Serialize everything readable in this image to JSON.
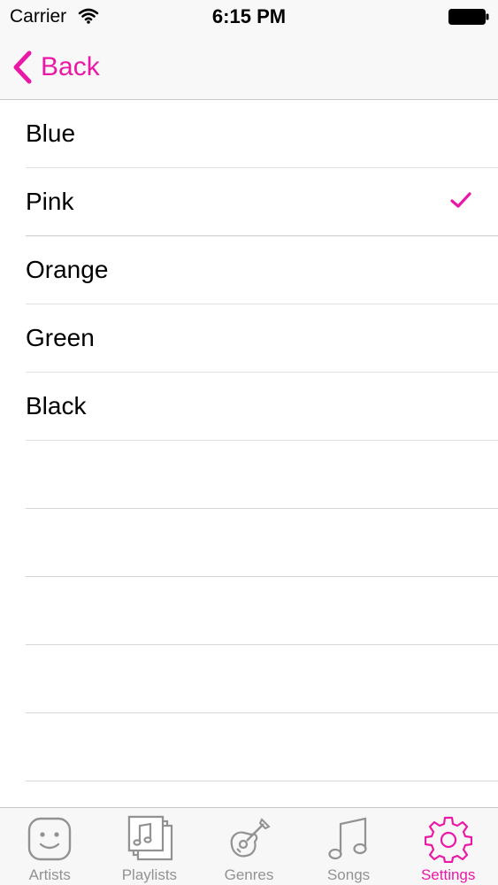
{
  "status_bar": {
    "carrier": "Carrier",
    "time": "6:15 PM"
  },
  "nav": {
    "back_label": "Back"
  },
  "colors": {
    "accent": "#e919a6",
    "inactive": "#929292"
  },
  "list": {
    "items": [
      {
        "label": "Blue",
        "selected": false
      },
      {
        "label": "Pink",
        "selected": true
      },
      {
        "label": "Orange",
        "selected": false
      },
      {
        "label": "Green",
        "selected": false
      },
      {
        "label": "Black",
        "selected": false
      }
    ],
    "empty_rows": 5
  },
  "tabs": [
    {
      "label": "Artists",
      "icon": "face-icon",
      "active": false
    },
    {
      "label": "Playlists",
      "icon": "playlist-icon",
      "active": false
    },
    {
      "label": "Genres",
      "icon": "guitar-icon",
      "active": false
    },
    {
      "label": "Songs",
      "icon": "music-note-icon",
      "active": false
    },
    {
      "label": "Settings",
      "icon": "gear-icon",
      "active": true
    }
  ]
}
